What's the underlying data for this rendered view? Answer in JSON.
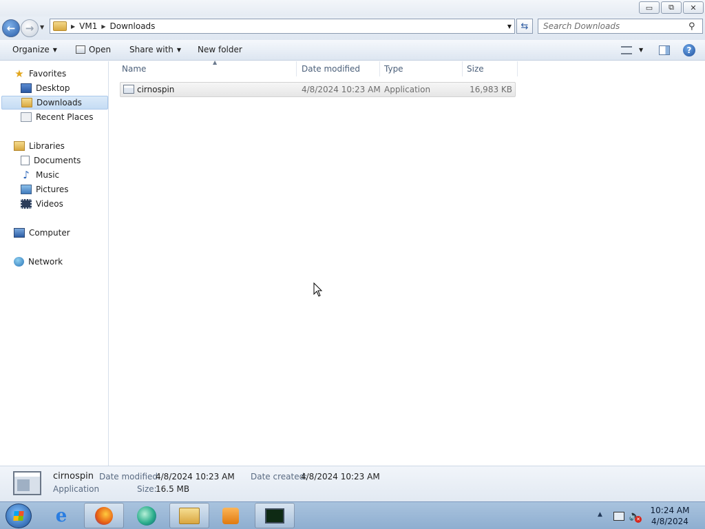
{
  "window": {
    "minimize": "▭",
    "restore": "⧉",
    "close": "✕"
  },
  "address": {
    "crumbs": [
      "VM1",
      "Downloads"
    ]
  },
  "search": {
    "placeholder": "Search Downloads"
  },
  "toolbar": {
    "organize": "Organize",
    "open": "Open",
    "share_with": "Share with",
    "new_folder": "New folder"
  },
  "nav": {
    "favorites": "Favorites",
    "desktop": "Desktop",
    "downloads": "Downloads",
    "recent_places": "Recent Places",
    "libraries": "Libraries",
    "documents": "Documents",
    "music": "Music",
    "pictures": "Pictures",
    "videos": "Videos",
    "computer": "Computer",
    "network": "Network"
  },
  "columns": {
    "name": "Name",
    "date_modified": "Date modified",
    "type": "Type",
    "size": "Size"
  },
  "files": [
    {
      "name": "cirnospin",
      "date_modified": "4/8/2024 10:23 AM",
      "type": "Application",
      "size": "16,983 KB"
    }
  ],
  "details": {
    "name": "cirnospin",
    "type": "Application",
    "date_modified_label": "Date modified:",
    "date_modified": "4/8/2024 10:23 AM",
    "date_created_label": "Date created:",
    "date_created": "4/8/2024 10:23 AM",
    "size_label": "Size:",
    "size": "16.5 MB"
  },
  "taskbar": {
    "time": "10:24 AM",
    "date": "4/8/2024",
    "items": [
      "internet-explorer",
      "firefox",
      "edge",
      "windows-explorer",
      "media-player",
      "task-manager"
    ],
    "active": "windows-explorer"
  },
  "colors": {
    "accent": "#2a5da8",
    "selection": "#c5dcf4",
    "taskbar": "#9ab6d6"
  }
}
